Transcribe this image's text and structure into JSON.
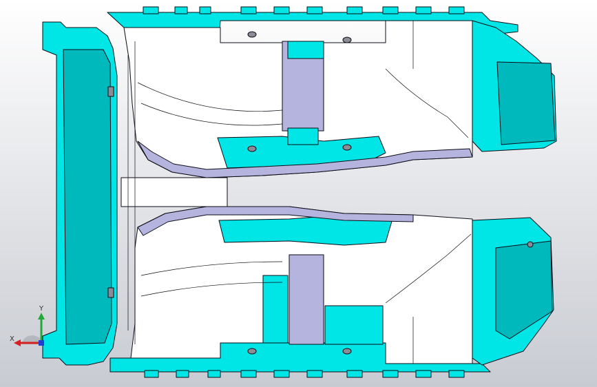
{
  "viewport": {
    "background_top": "#ffffff",
    "background_bottom": "#c8cbd2"
  },
  "model": {
    "name": "",
    "colors": {
      "primary": "#00e5e5",
      "primary_dark": "#00b9bc",
      "panel_light": "#ffffff",
      "panel_shade": "#b4b4de",
      "edge": "#0a0a14"
    }
  },
  "triad": {
    "x_label": "X",
    "y_label": "Y",
    "x_color": "#d62020",
    "y_color": "#22a83a"
  }
}
